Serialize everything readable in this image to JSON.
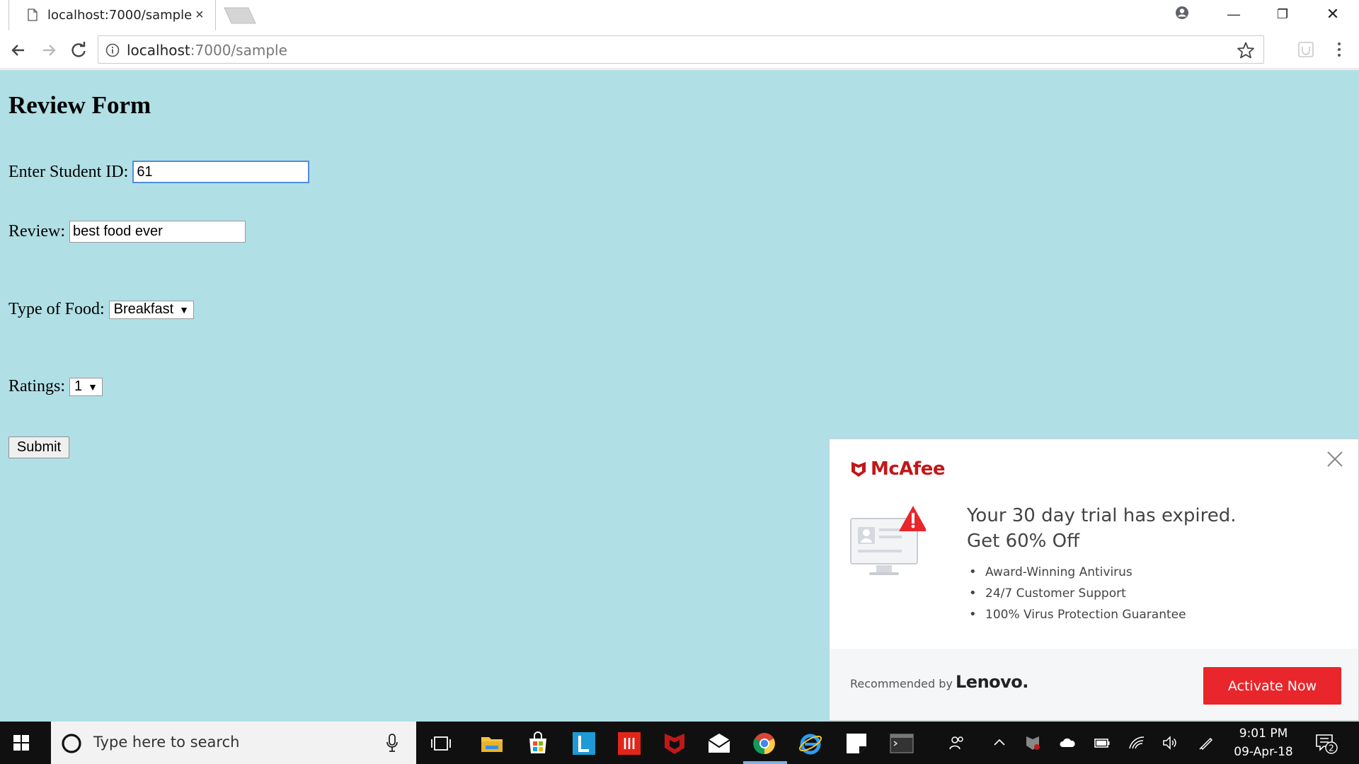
{
  "browser": {
    "tab_title": "localhost:7000/sample",
    "tab_close": "×",
    "url_host": "localhost",
    "url_path": ":7000/sample",
    "window_min": "—",
    "window_max": "❐",
    "window_close": "✕"
  },
  "form": {
    "title": "Review Form",
    "student_label": "Enter Student ID:",
    "student_value": "61",
    "review_label": "Review:",
    "review_value": "best food ever",
    "food_label": "Type of Food:",
    "food_value": "Breakfast",
    "rating_label": "Ratings:",
    "rating_value": "1",
    "dropdown_arrow": "▼",
    "submit_label": "Submit"
  },
  "popup": {
    "brand": "McAfee",
    "headline_1": "Your 30 day trial has expired.",
    "headline_2": "Get 60% Off",
    "bullets": [
      "Award-Winning Antivirus",
      "24/7 Customer Support",
      "100% Virus Protection Guarantee"
    ],
    "recommended_by": "Recommended by",
    "partner": "Lenovo.",
    "cta": "Activate Now",
    "colors": {
      "brand_red": "#c01818",
      "cta_red": "#e8262b"
    }
  },
  "taskbar": {
    "search_placeholder": "Type here to search",
    "time": "9:01 PM",
    "date": "09-Apr-18",
    "notification_count": "2"
  },
  "colors": {
    "page_background": "#b0dfe5",
    "taskbar": "#101010",
    "focus_border": "#4f8ee0"
  }
}
